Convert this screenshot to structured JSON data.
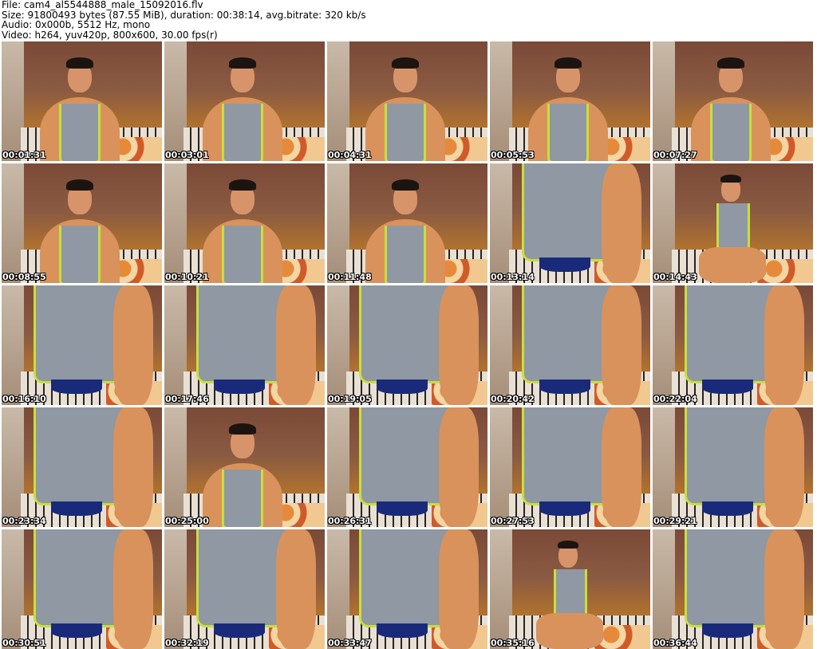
{
  "header": {
    "file_line": "File: cam4_al5544888_male_15092016.flv",
    "size_line": "Size: 91800493 bytes (87.55 MiB), duration: 00:38:14, avg.bitrate: 320 kb/s",
    "audio_line": "Audio: 0x000b, 5512 Hz, mono",
    "video_line": "Video: h264, yuv420p, 800x600, 30.00 fps(r)"
  },
  "thumbnails": [
    {
      "timestamp": "00:01:31",
      "pose": "face"
    },
    {
      "timestamp": "00:03:01",
      "pose": "face"
    },
    {
      "timestamp": "00:04:31",
      "pose": "face"
    },
    {
      "timestamp": "00:05:53",
      "pose": "face"
    },
    {
      "timestamp": "00:07:27",
      "pose": "face"
    },
    {
      "timestamp": "00:08:55",
      "pose": "face"
    },
    {
      "timestamp": "00:10:21",
      "pose": "face"
    },
    {
      "timestamp": "00:11:48",
      "pose": "face"
    },
    {
      "timestamp": "00:13:14",
      "pose": "torso"
    },
    {
      "timestamp": "00:14:43",
      "pose": "far"
    },
    {
      "timestamp": "00:16:10",
      "pose": "torso"
    },
    {
      "timestamp": "00:17:46",
      "pose": "torso"
    },
    {
      "timestamp": "00:19:05",
      "pose": "torso"
    },
    {
      "timestamp": "00:20:42",
      "pose": "torso"
    },
    {
      "timestamp": "00:22:04",
      "pose": "torso"
    },
    {
      "timestamp": "00:23:34",
      "pose": "torso"
    },
    {
      "timestamp": "00:25:00",
      "pose": "face"
    },
    {
      "timestamp": "00:26:31",
      "pose": "torso"
    },
    {
      "timestamp": "00:27:53",
      "pose": "torso"
    },
    {
      "timestamp": "00:29:21",
      "pose": "torso"
    },
    {
      "timestamp": "00:30:51",
      "pose": "torso"
    },
    {
      "timestamp": "00:32:19",
      "pose": "torso"
    },
    {
      "timestamp": "00:33:47",
      "pose": "torso"
    },
    {
      "timestamp": "00:35:16",
      "pose": "far"
    },
    {
      "timestamp": "00:36:44",
      "pose": "torso"
    }
  ]
}
